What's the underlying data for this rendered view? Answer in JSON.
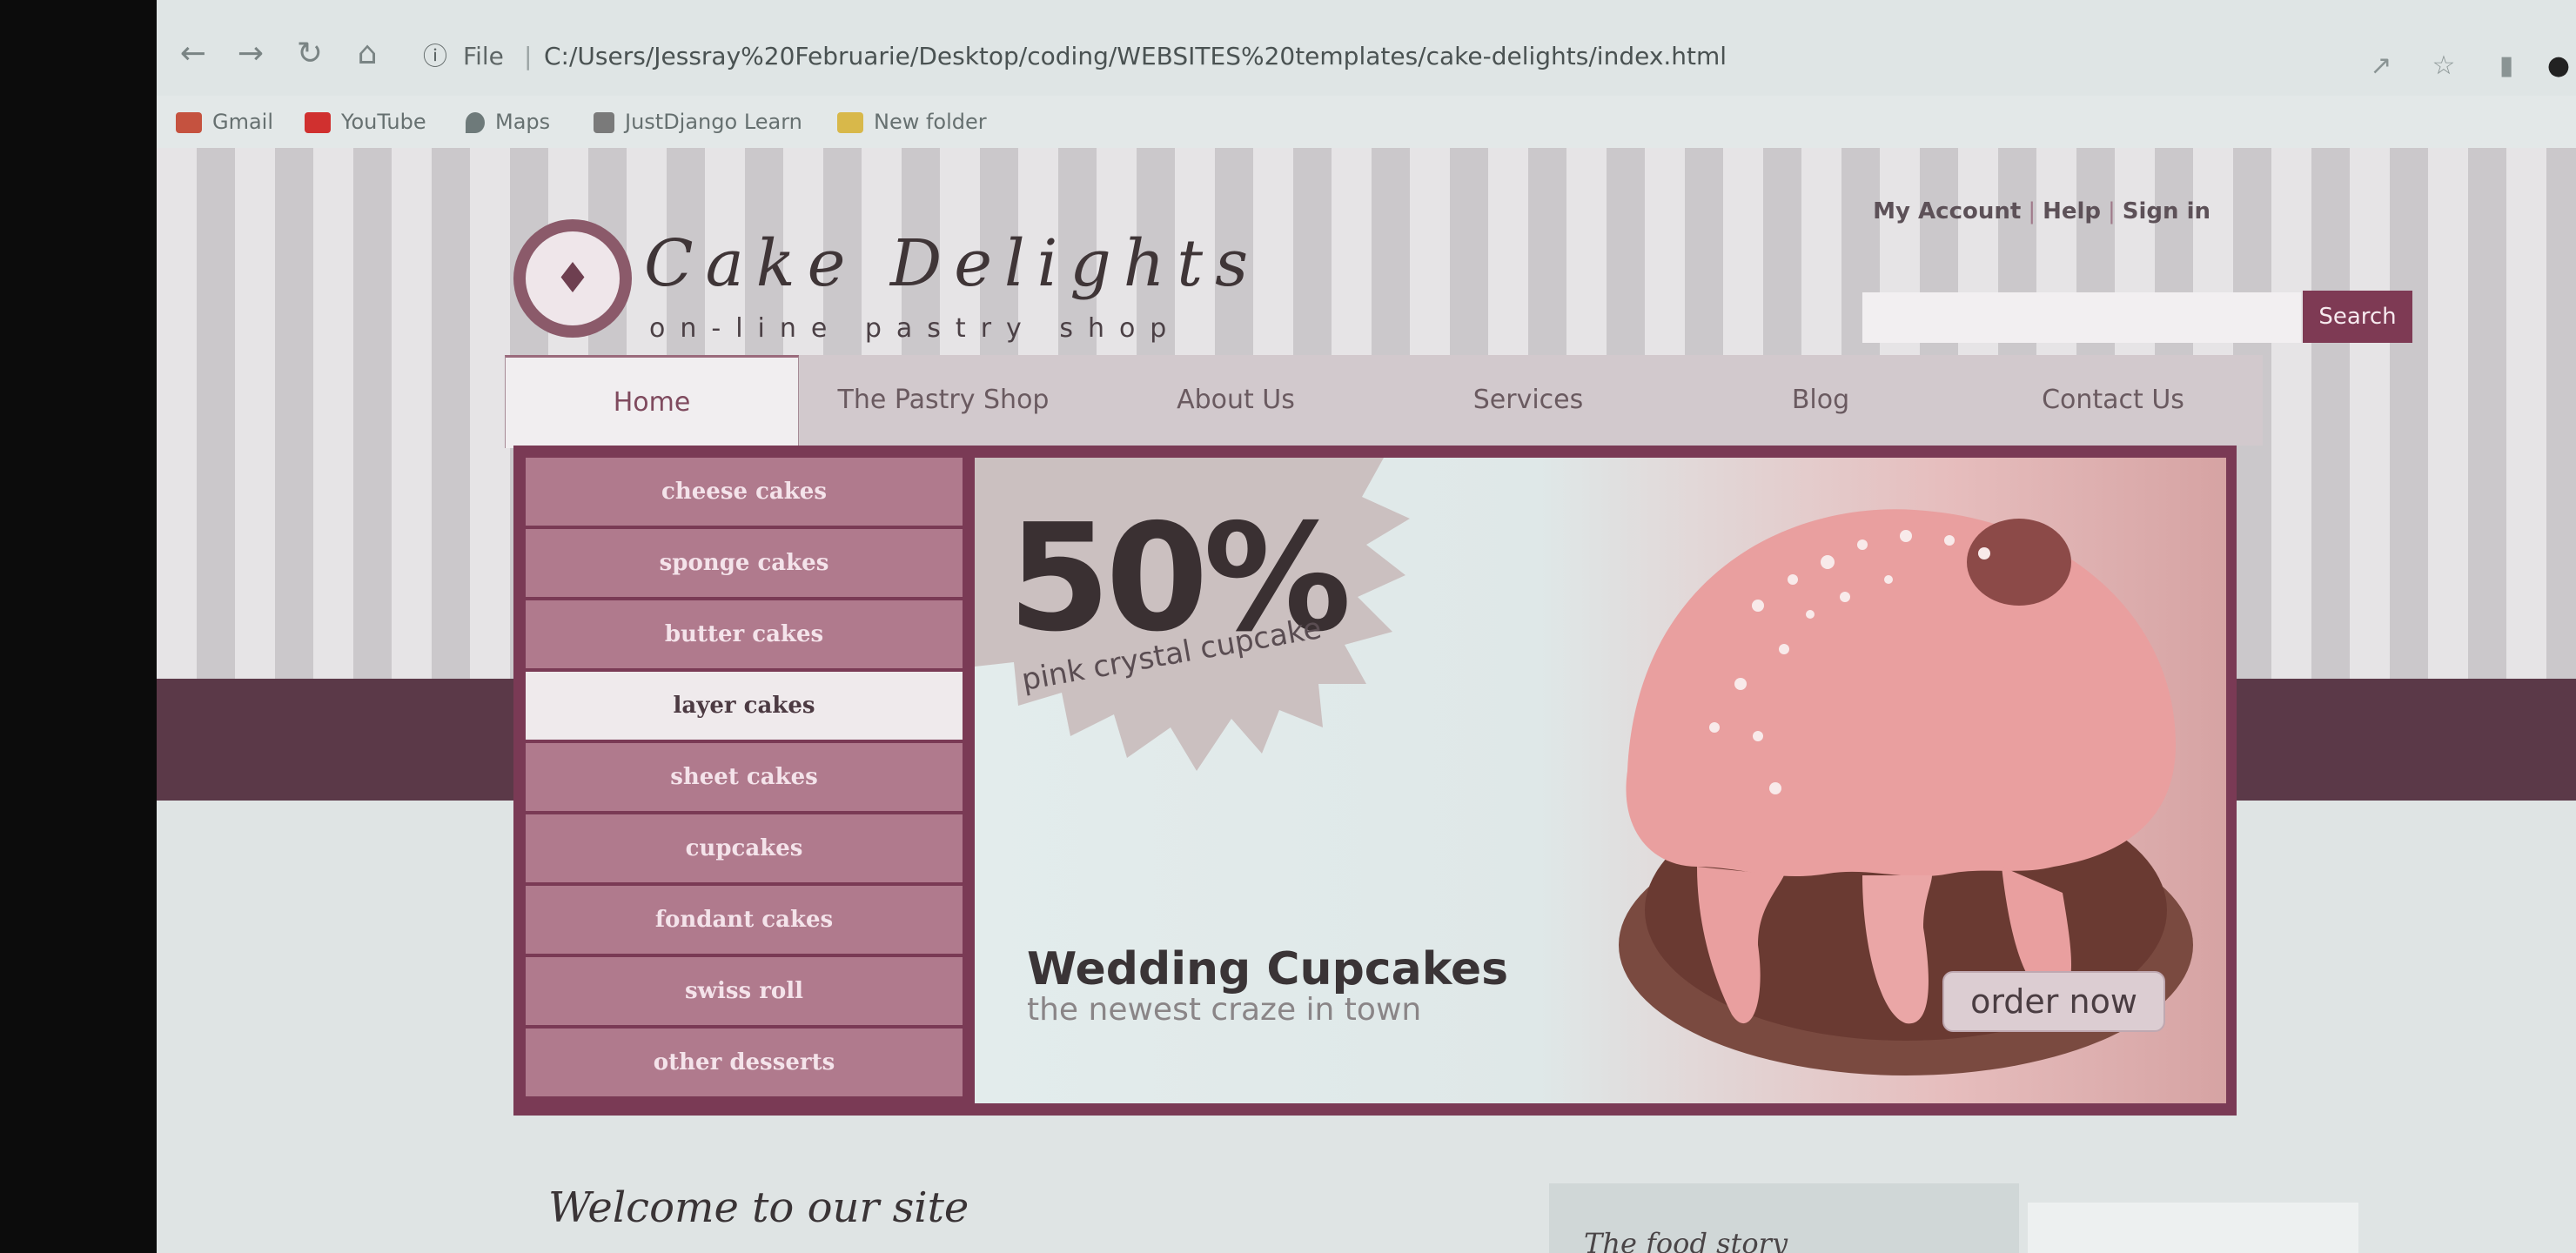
{
  "browser": {
    "url_info_icon": "info-icon",
    "url_scheme": "File",
    "url_separator": "|",
    "url": "C:/Users/Jessray%20Februarie/Desktop/coding/WEBSITES%20templates/cake-delights/index.html",
    "bookmarks": [
      {
        "label": "Gmail",
        "icon": "gmail-icon",
        "color": "#c5523f"
      },
      {
        "label": "YouTube",
        "icon": "youtube-icon",
        "color": "#d0302f"
      },
      {
        "label": "Maps",
        "icon": "maps-pin-icon",
        "color": "#6e7a7a"
      },
      {
        "label": "JustDjango Learn",
        "icon": "justdjango-icon",
        "color": "#7a7a7a"
      },
      {
        "label": "New folder",
        "icon": "folder-icon",
        "color": "#d8b84a"
      }
    ]
  },
  "site": {
    "logo_title": "Cake Delights",
    "logo_tagline": "on-line pastry shop",
    "account": {
      "my_account": "My Account",
      "sep": "|",
      "help": "Help",
      "sign_in": "Sign in"
    },
    "search": {
      "placeholder": "",
      "button": "Search"
    },
    "nav": [
      "Home",
      "The Pastry Shop",
      "About Us",
      "Services",
      "Blog",
      "Contact Us"
    ],
    "active_nav": "Home",
    "sidebar": [
      "cheese cakes",
      "sponge cakes",
      "butter cakes",
      "layer cakes",
      "sheet cakes",
      "cupcakes",
      "fondant cakes",
      "swiss roll",
      "other desserts"
    ],
    "active_sidebar": "layer cakes",
    "banner": {
      "discount": "50%",
      "discount_sub": "pink crystal cupcake",
      "title": "Wedding Cupcakes",
      "subtitle": "the newest craze in town",
      "order_button": "order now"
    },
    "welcome": "Welcome to our site",
    "food_story": "The food story"
  },
  "colors": {
    "brand": "#7a3a55",
    "accent": "#b07a8d",
    "band": "#5b3948"
  }
}
